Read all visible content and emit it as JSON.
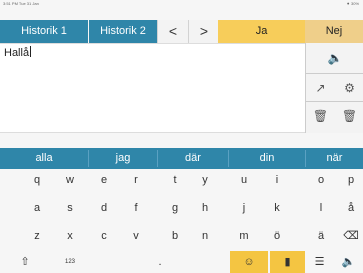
{
  "status": {
    "left": "3:51 PM  Tue 31 Jan",
    "right": "⚫ 30%"
  },
  "tabs": [
    {
      "label": "Historik 1"
    },
    {
      "label": "Historik 2"
    }
  ],
  "nav": {
    "back": "<",
    "forward": ">"
  },
  "answers": {
    "yes": "Ja",
    "no": "Nej"
  },
  "text_input": {
    "value": "Hallå"
  },
  "side_icons": {
    "speaker": "🔈",
    "expand": "↗",
    "settings": "⚙",
    "trash1": "🗑",
    "trash2": "🗑"
  },
  "word_predictions": [
    "alla",
    "jag",
    "där",
    "din",
    "när"
  ],
  "keyboard": {
    "row1": [
      "q",
      "w",
      "e",
      "r",
      "t",
      "y",
      "u",
      "i",
      "o",
      "p"
    ],
    "row2": [
      "a",
      "s",
      "d",
      "f",
      "g",
      "h",
      "j",
      "k",
      "l",
      "å"
    ],
    "row3": [
      "z",
      "x",
      "c",
      "v",
      "b",
      "n",
      "m",
      "ö",
      "ä",
      "⌫"
    ],
    "bottom": {
      "shift": "⇧",
      "numbers": "123",
      "period": ".",
      "emoji": "☺",
      "phrases": "▮",
      "menu": "☰",
      "speak": "🔈"
    }
  }
}
